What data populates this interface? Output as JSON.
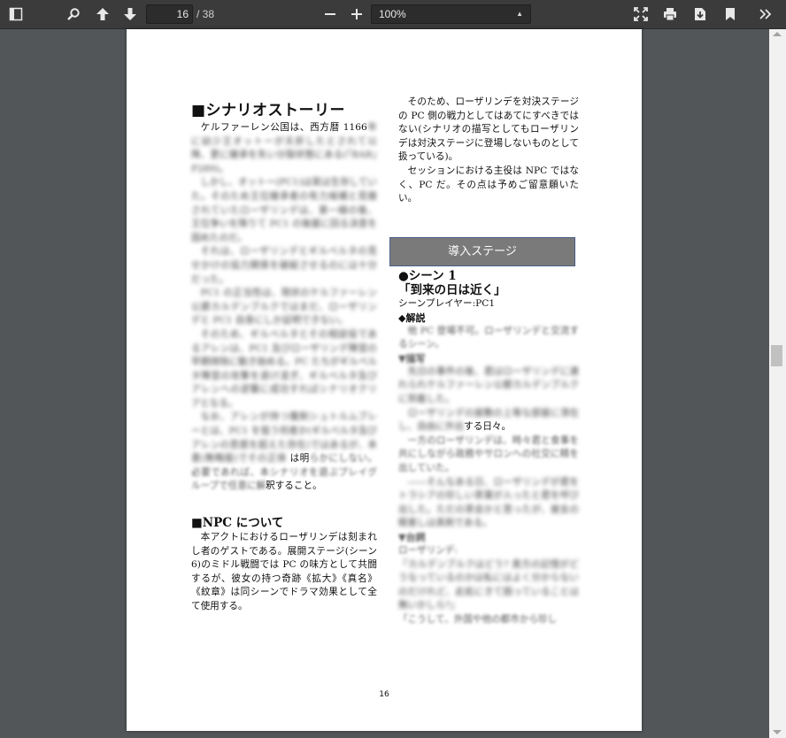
{
  "toolbar": {
    "current_page": "16",
    "total_pages": "/ 38",
    "zoom": "100%",
    "icons": [
      "sidebar-toggle-icon",
      "search-icon",
      "previous-page-icon",
      "next-page-icon",
      "zoom-out-icon",
      "zoom-in-icon",
      "presentation-mode-icon",
      "print-icon",
      "download-icon",
      "bookmark-icon",
      "more-tools-icon"
    ]
  },
  "page": {
    "number": "16",
    "left": {
      "heading1": "■シナリオストーリー",
      "p1_clear": "ケルファーレン公国は、西方暦 1166",
      "p1_blur": "年に幼少王オットーが夭折したとされて以降、更に継承を失い分裂状態にある(『BAR』P289)。",
      "p2_a": "しかし、オットー(PC1)は実は生存していた。そのため王位継承者の有力候補と見做されていたローザリンデは、第一線の後、王位争いを降りて PC1 の後援に回る決意を固めたのだ。",
      "p3": "それは、ローザリンデとギルベルタの見せかけの協力関係を破綻させるのには十分だった。",
      "p4": "PC1 の正当性は、現状のケルファーレン公爵カルデンブルクではまだ、ローザリンデと PC1 自身にしか証明できない。",
      "p5": "そのため、ギルベルタとその相談役であるアレンは、PC1 及びローザリンデ陣営の早期排除に動き始める。PC たちがギルベルタ陣営の攻撃を退け凌ぎ、ギルベルタ及びアレンへの逆襲に成功すればシナリオクリアとなる。",
      "p6_blur": "なお、アレンが持つ魔剣シュトルムブレーとは、PC1 を狙う何者か(ギルベルタ及びアレンの思惑を超えた存在)ではあるが、本書(無略版)でその正体",
      "p6_mixed_a": "は明",
      "p6_mixed_b": "らかにしない。必要であれば、本シナ",
      "p6_mixed_c": "リオを遊ぶプレイグループで任意に解",
      "p6_end": "釈すること。",
      "heading2": "■NPC について",
      "npc_p": "本アクトにおけるローザリンデは刻まれし者のゲストである。展開ステージ(シーン 6)のミドル戦闘では PC の味方として共闘するが、彼女の持つ奇跡《拡大》《真名》《紋章》は同シーンでドラマ効果として全て使用する。"
    },
    "right": {
      "p1": "そのため、ローザリンデを対決ステージの PC 側の戦力としてはあてにすべきではない(シナリオの描写としてもローザリンデは対決ステージに登場しないものとして扱っている)。",
      "p2": "セッションにおける主役は NPC ではなく、PC だ。その点は予めご留意願いたい。",
      "stage_box": "導入ステージ",
      "scene_title": "●シーン 1",
      "scene_subtitle": "「到来の日は近く」",
      "scene_player": "シーンプレイヤー:PC1",
      "kaisetsu_h": "◆解説",
      "kaisetsu": "他 PC 登場不可。ローザリンデと交流するシーン。",
      "byosha_h": "▼描写",
      "byosha1": "先日の事件の後、君はローザリンデに連れられケルファーレン公都カルデンブルクに到着した。",
      "byosha2_a": "ローザリンデの屋敷の上等な部屋に滞在し、自由に外出",
      "byosha2_b": "する日々。",
      "byosha3": "一方のローザリンデは、時々君と食事を共にしながら政務やサロンへの社交に精を出していた。",
      "byosha4": "――そんなある日、ローザリンデが君をトラシアの珍しい茶葉が入ったと君を呼び出した。ただの茶会かと思ったが、彼女の眼差しは真剣である。",
      "daishi_h": "▼台詞",
      "speaker": "ローザリンデ:",
      "line1": "「カルデンブルクはどう? 貴方の記憶がどうなっているのかは私にはよく分からないのだけれど、此処にきて困っていることは無いかしら?」",
      "line2": "「こうして、外国や他の都市から珍し"
    }
  }
}
